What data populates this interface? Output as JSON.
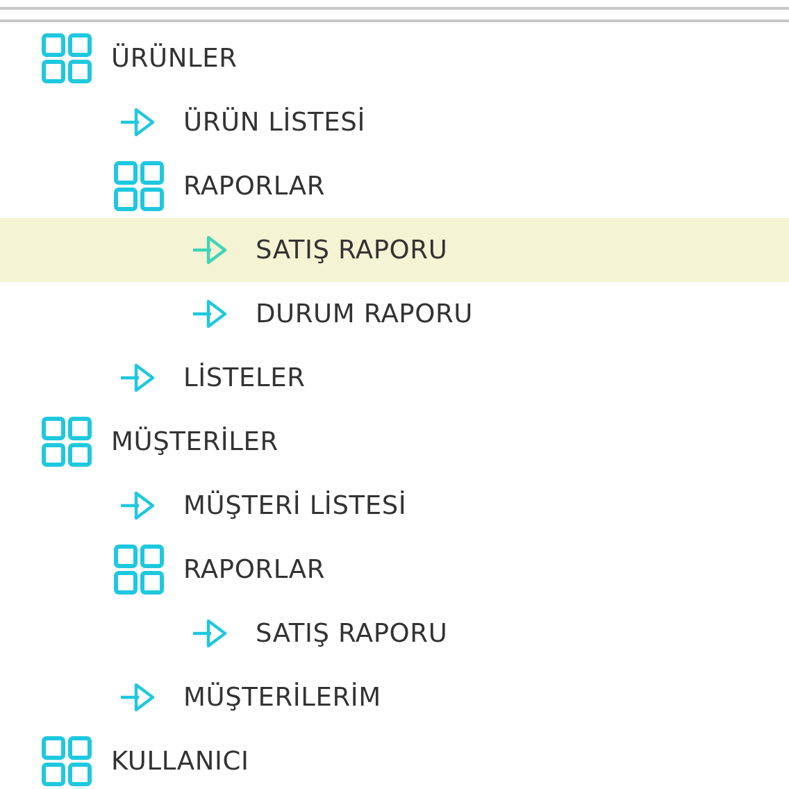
{
  "tree": [
    {
      "kind": "group",
      "label": "ÜRÜNLER",
      "selected": false,
      "children": [
        {
          "kind": "item",
          "label": "ÜRÜN LİSTESİ",
          "selected": false
        },
        {
          "kind": "group",
          "label": "RAPORLAR",
          "selected": false,
          "children": [
            {
              "kind": "item",
              "label": "SATIŞ RAPORU",
              "selected": true
            },
            {
              "kind": "item",
              "label": "DURUM RAPORU",
              "selected": false
            }
          ]
        },
        {
          "kind": "item",
          "label": "LİSTELER",
          "selected": false
        }
      ]
    },
    {
      "kind": "group",
      "label": "MÜŞTERİLER",
      "selected": false,
      "children": [
        {
          "kind": "item",
          "label": "MÜŞTERİ LİSTESİ",
          "selected": false
        },
        {
          "kind": "group",
          "label": "RAPORLAR",
          "selected": false,
          "children": [
            {
              "kind": "item",
              "label": "SATIŞ RAPORU",
              "selected": false
            }
          ]
        },
        {
          "kind": "item",
          "label": "MÜŞTERİLERİM",
          "selected": false
        }
      ]
    },
    {
      "kind": "group",
      "label": "KULLANICI",
      "selected": false
    }
  ]
}
